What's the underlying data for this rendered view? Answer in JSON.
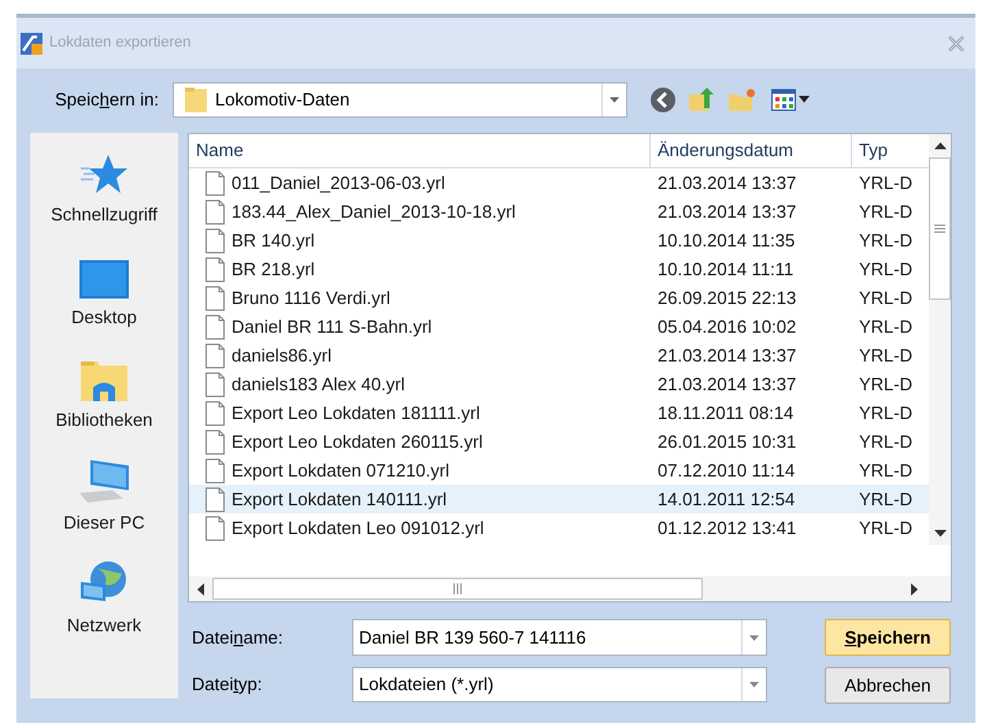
{
  "window": {
    "title": "Lokdaten exportieren"
  },
  "save_in": {
    "label": {
      "before": "Speic",
      "key": "h",
      "after": "ern in:"
    },
    "value": "Lokomotiv-Daten"
  },
  "places": [
    {
      "kind": "star",
      "label": "Schnellzugriff"
    },
    {
      "kind": "desktop",
      "label": "Desktop"
    },
    {
      "kind": "library",
      "label": "Bibliotheken"
    },
    {
      "kind": "pc",
      "label": "Dieser PC"
    },
    {
      "kind": "network",
      "label": "Netzwerk"
    }
  ],
  "table": {
    "columns": [
      "Name",
      "Änderungsdatum",
      "Typ"
    ],
    "rows": [
      {
        "name": "011_Daniel_2013-06-03.yrl",
        "date": "21.03.2014 13:37",
        "type": "YRL-D",
        "selected": false
      },
      {
        "name": "183.44_Alex_Daniel_2013-10-18.yrl",
        "date": "21.03.2014 13:37",
        "type": "YRL-D",
        "selected": false
      },
      {
        "name": "BR 140.yrl",
        "date": "10.10.2014 11:35",
        "type": "YRL-D",
        "selected": false
      },
      {
        "name": "BR 218.yrl",
        "date": "10.10.2014 11:11",
        "type": "YRL-D",
        "selected": false
      },
      {
        "name": "Bruno 1116 Verdi.yrl",
        "date": "26.09.2015 22:13",
        "type": "YRL-D",
        "selected": false
      },
      {
        "name": "Daniel BR 111 S-Bahn.yrl",
        "date": "05.04.2016 10:02",
        "type": "YRL-D",
        "selected": false
      },
      {
        "name": "daniels86.yrl",
        "date": "21.03.2014 13:37",
        "type": "YRL-D",
        "selected": false
      },
      {
        "name": "daniels183 Alex 40.yrl",
        "date": "21.03.2014 13:37",
        "type": "YRL-D",
        "selected": false
      },
      {
        "name": "Export Leo Lokdaten 181111.yrl",
        "date": "18.11.2011 08:14",
        "type": "YRL-D",
        "selected": false
      },
      {
        "name": "Export Leo Lokdaten 260115.yrl",
        "date": "26.01.2015 10:31",
        "type": "YRL-D",
        "selected": false
      },
      {
        "name": "Export Lokdaten 071210.yrl",
        "date": "07.12.2010 11:14",
        "type": "YRL-D",
        "selected": false
      },
      {
        "name": "Export Lokdaten 140111.yrl",
        "date": "14.01.2011 12:54",
        "type": "YRL-D",
        "selected": true
      },
      {
        "name": "Export Lokdaten Leo 091012.yrl",
        "date": "01.12.2012 13:41",
        "type": "YRL-D",
        "selected": false
      }
    ]
  },
  "file_name": {
    "label": {
      "before": "Datei",
      "key": "n",
      "after": "ame:"
    },
    "value": "Daniel BR 139 560-7 141116"
  },
  "file_type": {
    "label": {
      "before": "Datei",
      "key": "t",
      "after": "yp:"
    },
    "value": "Lokdateien (*.yrl)"
  },
  "buttons": [
    {
      "kind": "default",
      "label": {
        "key": "S",
        "after": "peichern"
      }
    },
    {
      "kind": "normal",
      "label": {
        "after": "Abbrechen"
      }
    }
  ]
}
